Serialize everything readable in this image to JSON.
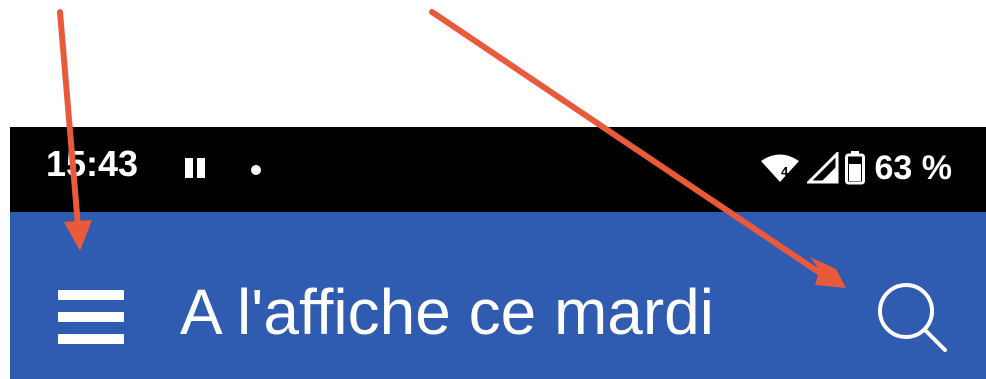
{
  "status_bar": {
    "time": "15:43",
    "battery_percent": "63 %",
    "icons": [
      "pause-icon",
      "notification-dot-icon",
      "wifi-icon",
      "cellular-signal-icon",
      "battery-icon"
    ]
  },
  "app_bar": {
    "title": "A l'affiche ce mardi",
    "left_icon": "menu-icon",
    "right_icon": "search-icon",
    "background_color": "#2f5bb0"
  },
  "annotations": {
    "arrow_color": "#e85a3a",
    "arrows": [
      "arrow-to-menu",
      "arrow-to-search"
    ]
  }
}
